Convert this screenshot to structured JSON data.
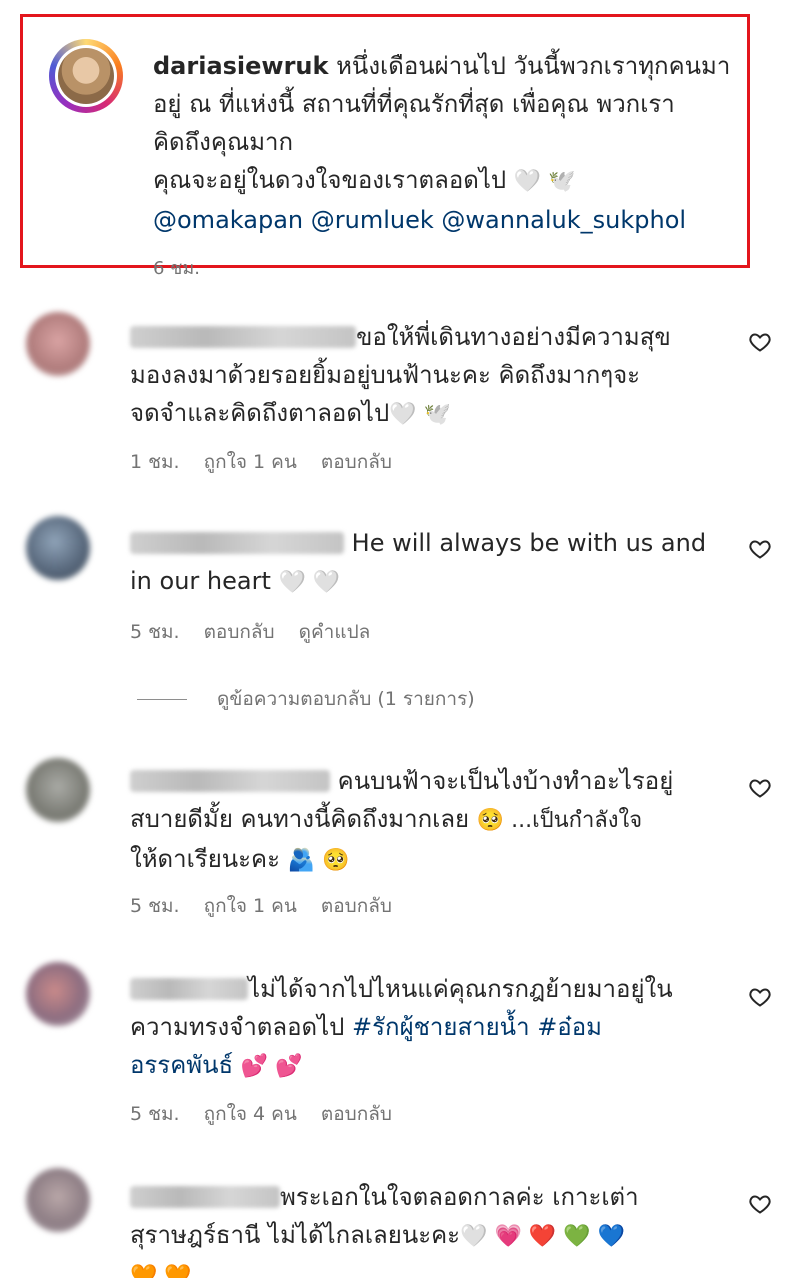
{
  "caption": {
    "username": "dariasiewruk",
    "line1": " หนึ่งเดือนผ่านไป วันนี้พวกเราทุกคนมา",
    "line2": "อยู่ ณ ที่แห่งนี้ สถานที่ที่คุณรักที่สุด เพื่อคุณ พวกเรา",
    "line3": "คิดถึงคุณมาก",
    "line4": "คุณจะอยู่ในดวงใจของเราตลอดไป",
    "line4_emoji": "🤍 🕊️",
    "mentions": [
      "@omakapan",
      "@rumluek",
      "@wannaluk_sukphol"
    ],
    "time": "6 ชม."
  },
  "comments": [
    {
      "lines": [
        "ขอให้พี่เดินทางอย่างมีความสุข",
        "มองลงมาด้วยรอยยิ้มอยู่บนฟ้านะคะ คิดถึงมากๆจะ",
        "จดจำและคิดถึงตาลอดไป"
      ],
      "emoji": "🤍 🕊️",
      "time": "1 ชม.",
      "likes": "ถูกใจ 1 คน",
      "reply": "ตอบกลับ"
    },
    {
      "lines": [
        "He will always be with us and",
        "in our heart"
      ],
      "emoji": "🤍 🤍",
      "time": "5 ชม.",
      "reply": "ตอบกลับ",
      "translate": "ดูคำแปล"
    },
    {
      "lines": [
        "คนบนฟ้าจะเป็นไงบ้างทำอะไรอยู่",
        "สบายดีมั้ย คนทางนี้คิดถึงมากเลย",
        "ให้ดาเรียนะคะ"
      ],
      "emoji_mid": "🥺 ...เป็นกำลังใจ",
      "emoji": "🫂 🥺",
      "time": "5 ชม.",
      "likes": "ถูกใจ 1 คน",
      "reply": "ตอบกลับ"
    },
    {
      "lines": [
        "ไม่ได้จากไปไหนแค่คุณกรกฎย้ายมาอยู่ใน",
        "ความทรงจำตลอดไป"
      ],
      "hashtags": [
        "#รักผู้ชายสายน้ำ",
        "#อ๋อม",
        "อรรคพันธ์"
      ],
      "emoji": "💕 💕",
      "time": "5 ชม.",
      "likes": "ถูกใจ 4 คน",
      "reply": "ตอบกลับ"
    },
    {
      "lines": [
        "พระเอกในใจตลอดกาลค่ะ เกาะเต่า",
        "สุราษฎร์ธานี ไม่ได้ไกลเลยนะคะ"
      ],
      "emoji": "🤍 💗 ❤️ 💚 💙",
      "emoji2": "🧡 🧡"
    }
  ],
  "view_replies": "ดูข้อความตอบกลับ (1 รายการ)",
  "colors": {
    "link": "#00376b",
    "highlight_border": "#e3161c",
    "muted": "#737373"
  }
}
